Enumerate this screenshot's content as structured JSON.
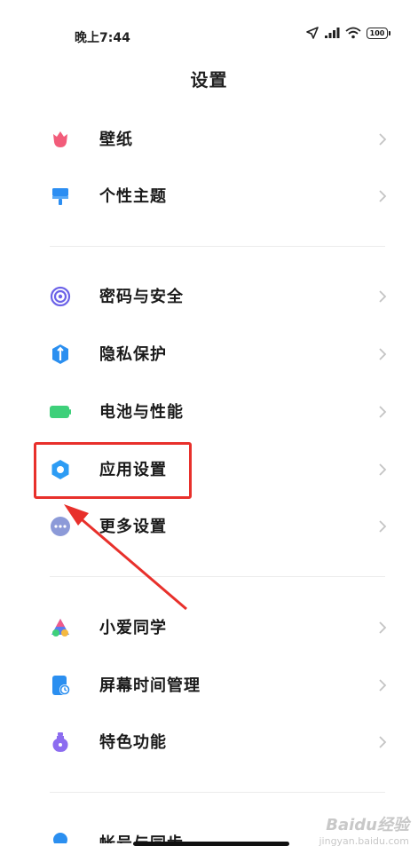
{
  "status": {
    "time": "晚上7:44",
    "battery": "100",
    "icons": [
      "location-icon",
      "signal-icon",
      "wifi-icon",
      "battery-icon"
    ]
  },
  "header": {
    "title": "设置"
  },
  "groups": [
    {
      "items": [
        {
          "label": "壁纸",
          "icon": "wallpaper-icon",
          "color": "#f25c7a"
        },
        {
          "label": "个性主题",
          "icon": "theme-brush-icon",
          "color": "#2c8ef2"
        }
      ]
    },
    {
      "items": [
        {
          "label": "密码与安全",
          "icon": "fingerprint-icon",
          "color": "#6c63e8"
        },
        {
          "label": "隐私保护",
          "icon": "privacy-shield-icon",
          "color": "#2b8ff0"
        },
        {
          "label": "电池与性能",
          "icon": "battery-performance-icon",
          "color": "#3ed07a"
        },
        {
          "label": "应用设置",
          "icon": "app-settings-gear-icon",
          "color": "#2d9cf4"
        },
        {
          "label": "更多设置",
          "icon": "more-settings-icon",
          "color": "#8c9ad8"
        }
      ]
    },
    {
      "items": [
        {
          "label": "小爱同学",
          "icon": "xiaoai-icon",
          "color": "#5a7cf0"
        },
        {
          "label": "屏幕时间管理",
          "icon": "screen-time-icon",
          "color": "#2b8ff0"
        },
        {
          "label": "特色功能",
          "icon": "features-icon",
          "color": "#8c6cf0"
        }
      ]
    }
  ],
  "annotation": {
    "highlighted_item": "应用设置",
    "highlight_color": "#e8302b"
  },
  "watermark": {
    "main": "Baidu经验",
    "sub": "jingyan.baidu.com"
  },
  "partial_bottom_item": {
    "label": "帐号与同步",
    "icon": "account-icon"
  }
}
